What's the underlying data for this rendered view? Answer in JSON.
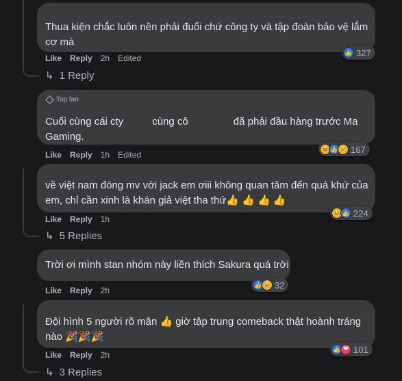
{
  "comments": [
    {
      "lines": [
        "Thua kiện chắc luôn nên phải đuổi chứ công ty và tập đoàn bảo vệ lắm",
        "cơ mà"
      ],
      "reactions": [
        "like"
      ],
      "reaction_count": "327",
      "actions": {
        "like": "Like",
        "reply": "Reply",
        "time": "2h",
        "edited": "Edited"
      },
      "replies_label": "1 Reply"
    },
    {
      "badge": "Top fan",
      "line1_a": "Cuối cùng cái cty",
      "line1_b": "cùng cô",
      "line1_c": "đã phải đầu hàng trước Ma",
      "line2": "Gaming.",
      "reactions": [
        "haha",
        "like",
        "sad"
      ],
      "reaction_count": "167",
      "actions": {
        "like": "Like",
        "reply": "Reply",
        "time": "1h",
        "edited": "Edited"
      }
    },
    {
      "lines": [
        "về việt nam đóng mv với jack em ơiii không quan tâm đến quá khứ của",
        "em, chỉ cần xinh là khán giả việt tha thứ👍 👍 👍 👍"
      ],
      "reactions": [
        "haha",
        "like"
      ],
      "reaction_count": "224",
      "actions": {
        "like": "Like",
        "reply": "Reply",
        "time": "1h"
      },
      "replies_label": "5 Replies"
    },
    {
      "lines": [
        "Trời ơi mình stan nhóm này liền thích Sakura quá trời"
      ],
      "reactions": [
        "like",
        "haha"
      ],
      "reaction_count": "32",
      "actions": {
        "like": "Like",
        "reply": "Reply",
        "time": "2h"
      }
    },
    {
      "lines": [
        "Đội hình 5 người rõ mận 👍 giờ tập trung comeback thật hoành tráng",
        "nào 🎉🎉🎉"
      ],
      "reactions": [
        "like",
        "love"
      ],
      "reaction_count": "101",
      "actions": {
        "like": "Like",
        "reply": "Reply",
        "time": "2h"
      },
      "replies_label": "3 Replies"
    }
  ],
  "icons": {
    "reply_arrow": "↳",
    "like": "👍",
    "haha": "😆",
    "sad": "😢",
    "love": "❤",
    "top_fan": "diamond-icon"
  },
  "colors": {
    "background": "#18191a",
    "bubble": "#3a3b3c",
    "text": "#e4e6eb",
    "muted": "#b0b3b8",
    "like_blue": "#2078f4",
    "love_red": "#f33e58",
    "haha_yellow": "#f7b125"
  }
}
